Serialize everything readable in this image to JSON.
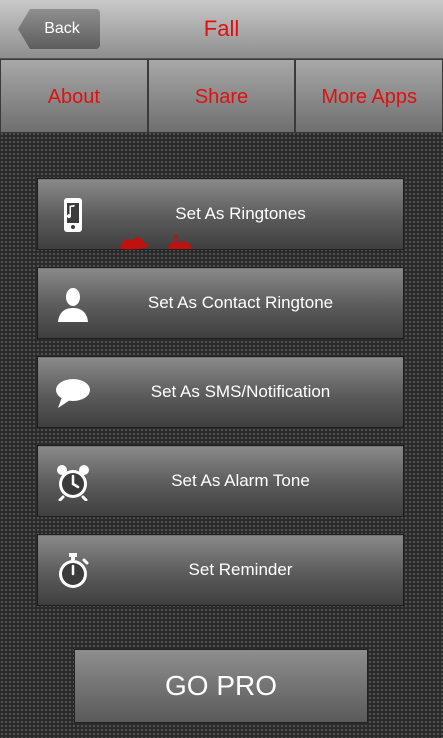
{
  "header": {
    "back_label": "Back",
    "title": "Fall"
  },
  "tabs": [
    {
      "label": "About"
    },
    {
      "label": "Share"
    },
    {
      "label": "More Apps"
    }
  ],
  "menu": {
    "items": [
      {
        "label": "Set As Ringtones",
        "icon": "phone-music-icon"
      },
      {
        "label": "Set As Contact Ringtone",
        "icon": "contact-person-icon"
      },
      {
        "label": "Set As SMS/Notification",
        "icon": "speech-bubble-icon"
      },
      {
        "label": "Set As Alarm Tone",
        "icon": "alarm-clock-icon"
      },
      {
        "label": "Set Reminder",
        "icon": "stopwatch-icon"
      }
    ]
  },
  "gopro": {
    "label": "GO PRO"
  },
  "colors": {
    "accent_text": "#e01010",
    "button_text": "#ffffff"
  }
}
